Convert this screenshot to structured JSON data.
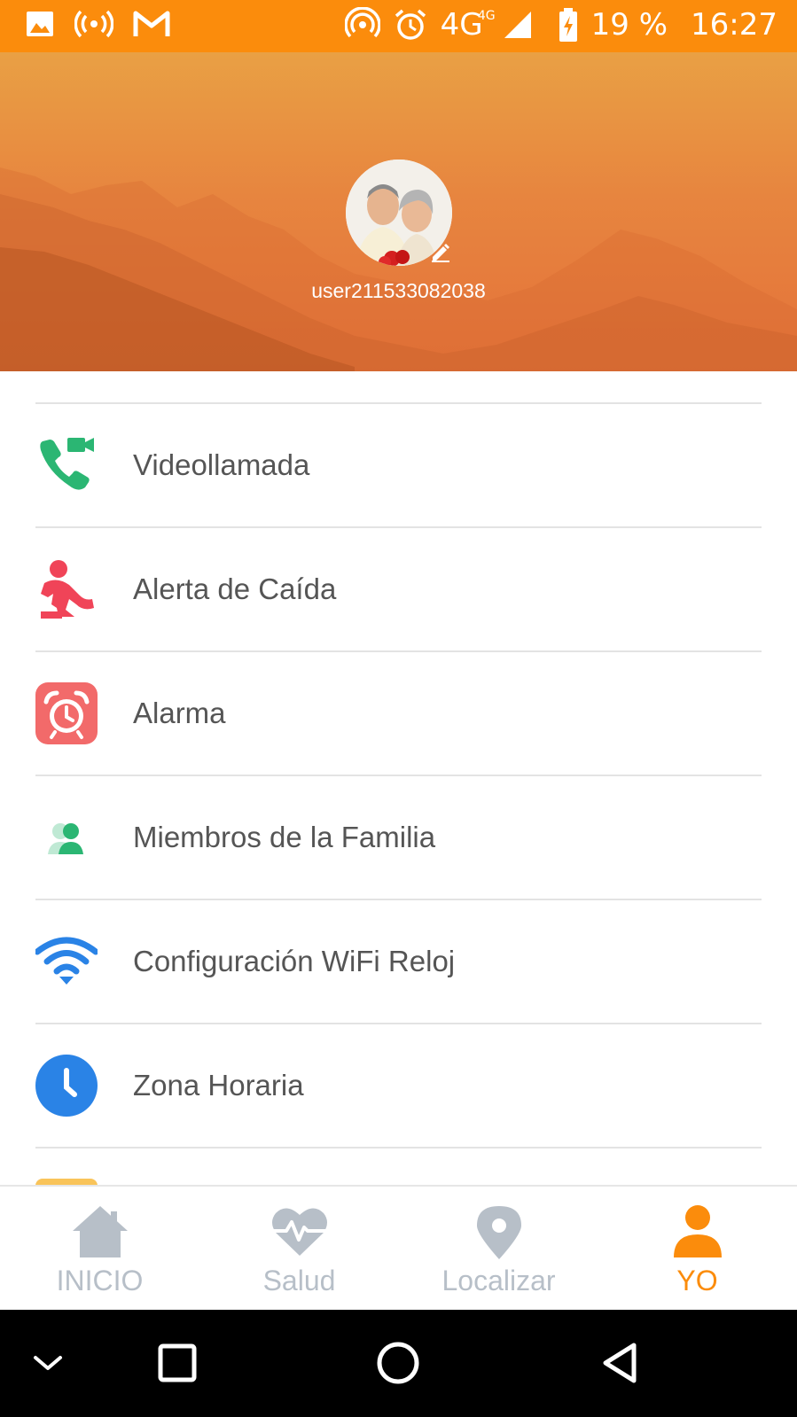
{
  "status_bar": {
    "battery": "19 %",
    "time": "16:27",
    "network": "4G",
    "network_super": "4G",
    "icons": [
      "image-icon",
      "hotspot-icon",
      "gmail-icon",
      "wifi-calling-icon",
      "alarm-clock-icon",
      "signal-icon",
      "battery-charging-icon"
    ],
    "background": "#fb8c0c"
  },
  "profile": {
    "username": "user211533082038",
    "avatar": "avatar",
    "edit_icon": "edit-pencil-icon"
  },
  "menu": {
    "items": [
      {
        "label": "Videollamada",
        "icon": "video-call-icon",
        "color": "#2bb673"
      },
      {
        "label": "Alerta de Caída",
        "icon": "fall-alert-icon",
        "color": "#f04458"
      },
      {
        "label": "Alarma",
        "icon": "alarm-icon",
        "color": "#f26a6a"
      },
      {
        "label": "Miembros de la Familia",
        "icon": "family-members-icon",
        "color": "#2bb673"
      },
      {
        "label": "Configuración WiFi Reloj",
        "icon": "wifi-icon",
        "color": "#2a83e6"
      },
      {
        "label": "Zona Horaria",
        "icon": "timezone-clock-icon",
        "color": "#2a83e6"
      }
    ]
  },
  "bottom_nav": {
    "items": [
      {
        "label": "INICIO",
        "icon": "home-icon",
        "active": false
      },
      {
        "label": "Salud",
        "icon": "heart-pulse-icon",
        "active": false
      },
      {
        "label": "Localizar",
        "icon": "location-pin-icon",
        "active": false
      },
      {
        "label": "YO",
        "icon": "person-icon",
        "active": true
      }
    ],
    "active_color": "#fb8c0c",
    "inactive_color": "#b7bfc8"
  },
  "system_nav": {
    "buttons": [
      "chevron-down-icon",
      "recents-square-icon",
      "home-circle-icon",
      "back-triangle-icon"
    ]
  }
}
